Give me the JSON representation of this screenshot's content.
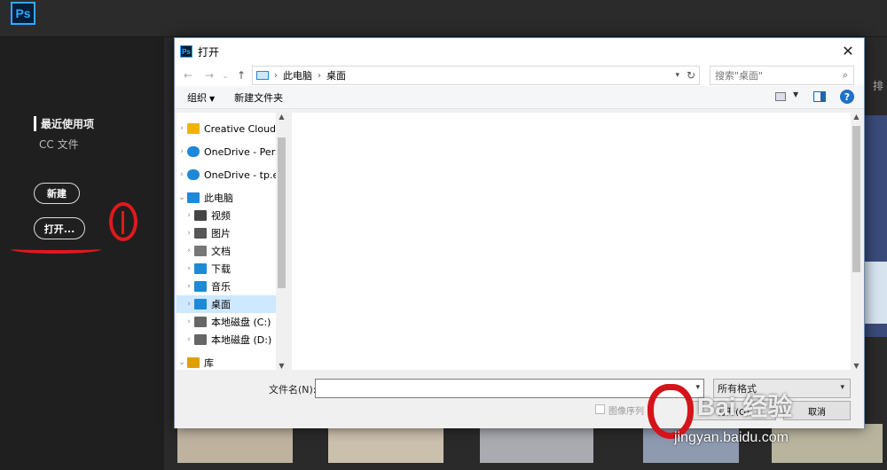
{
  "ps": {
    "logo": "Ps",
    "recent": "最近使用项",
    "cc_files": "CC 文件",
    "new_btn": "新建",
    "open_btn": "打开...",
    "sort_label": "排"
  },
  "dialog": {
    "title": "打开",
    "close": "✕",
    "address": {
      "crumbs": [
        "此电脑",
        "桌面"
      ]
    },
    "search_placeholder": "搜索\"桌面\"",
    "toolbar": {
      "organize": "组织",
      "new_folder": "新建文件夹",
      "help": "?"
    },
    "nav": [
      {
        "label": "Creative Cloud F",
        "icon": "creative-cloud-folder-icon",
        "color": "#f0b400"
      },
      {
        "label": "OneDrive - Perso",
        "icon": "onedrive-icon",
        "color": "#1e88d8"
      },
      {
        "label": "OneDrive - tp.ed",
        "icon": "onedrive-icon",
        "color": "#1e88d8"
      },
      {
        "label": "此电脑",
        "icon": "this-pc-icon",
        "color": "#1c8ad6"
      },
      {
        "label": "视频",
        "icon": "video-icon",
        "color": "#444"
      },
      {
        "label": "图片",
        "icon": "pictures-icon",
        "color": "#555"
      },
      {
        "label": "文档",
        "icon": "documents-icon",
        "color": "#777"
      },
      {
        "label": "下载",
        "icon": "download-icon",
        "color": "#1c8ad6"
      },
      {
        "label": "音乐",
        "icon": "music-icon",
        "color": "#1c8ad6"
      },
      {
        "label": "桌面",
        "icon": "desktop-icon",
        "color": "#1c8ad6"
      },
      {
        "label": "本地磁盘 (C:)",
        "icon": "disk-c-icon",
        "color": "#666"
      },
      {
        "label": "本地磁盘 (D:)",
        "icon": "disk-d-icon",
        "color": "#666"
      },
      {
        "label": "库",
        "icon": "library-icon",
        "color": "#e0a000"
      }
    ],
    "filename_label": "文件名(N):",
    "filename_value": "",
    "file_type": "所有格式",
    "image_sequence": "图像序列",
    "open_btn": "打开(O)",
    "cancel_btn": "取消"
  },
  "watermark": {
    "brand": "Bai 经验",
    "url": "jingyan.baidu.com"
  }
}
